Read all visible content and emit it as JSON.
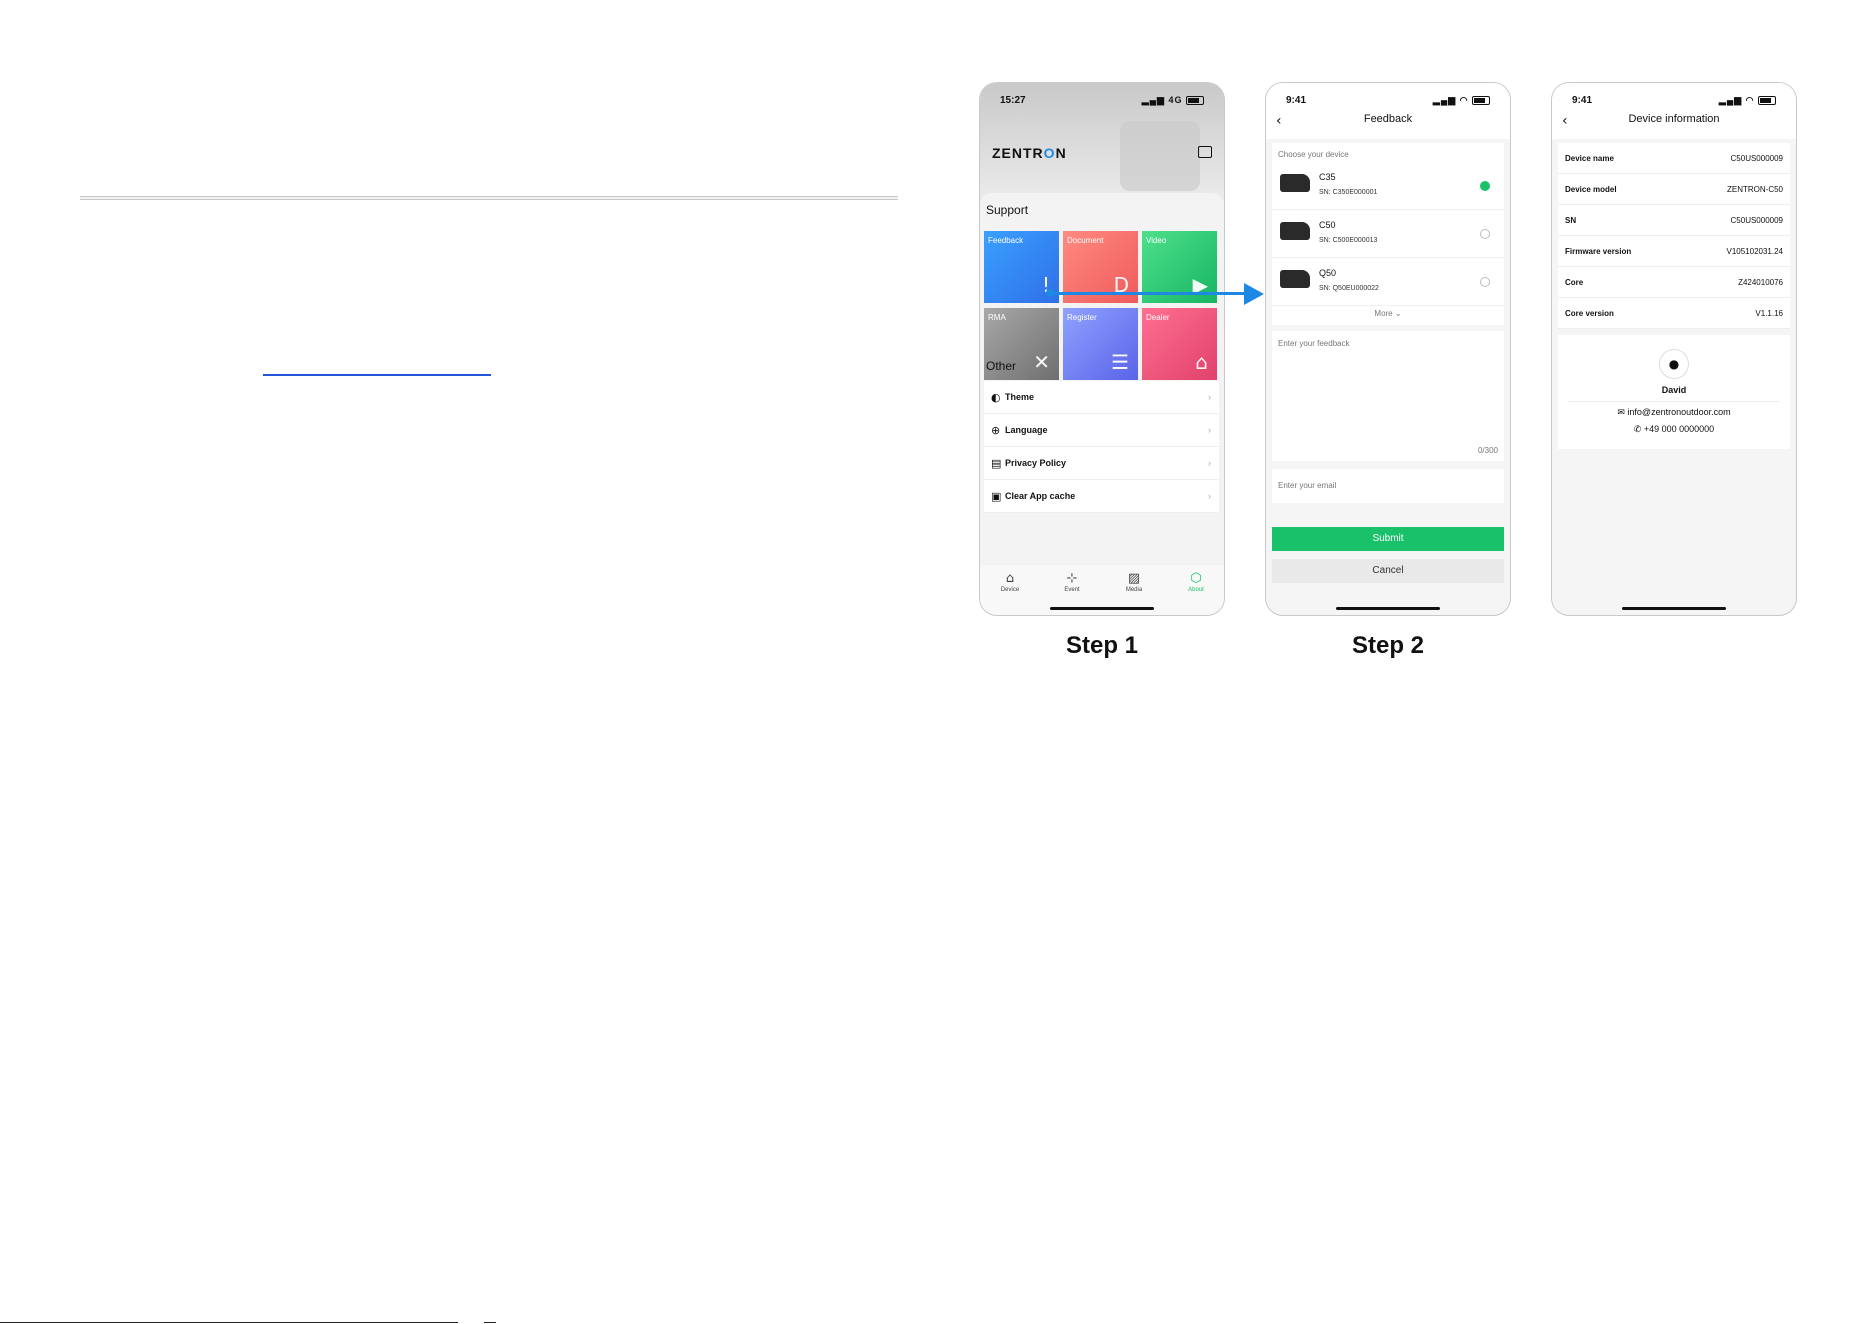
{
  "colors": {
    "accent_green": "#19c26a",
    "arrow_blue": "#1e88e5",
    "link_blue": "#2157d6"
  },
  "phone1": {
    "status_time": "15:27",
    "status_network": "4G",
    "logo_prefix": "ZENTR",
    "logo_o": "O",
    "logo_suffix": "N",
    "support_title": "Support",
    "tiles": [
      {
        "label": "Feedback",
        "icon": "feedback-icon",
        "glyph": "!"
      },
      {
        "label": "Document",
        "icon": "document-icon",
        "glyph": "D"
      },
      {
        "label": "Video",
        "icon": "video-icon",
        "glyph": "▶"
      },
      {
        "label": "RMA",
        "icon": "tools-icon",
        "glyph": "✕"
      },
      {
        "label": "Register",
        "icon": "list-icon",
        "glyph": "☰"
      },
      {
        "label": "Dealer",
        "icon": "store-icon",
        "glyph": "⌂"
      }
    ],
    "other_title": "Other",
    "other_items": [
      {
        "label": "Theme",
        "icon": "theme-icon",
        "glyph": "◐"
      },
      {
        "label": "Language",
        "icon": "globe-icon",
        "glyph": "⊕"
      },
      {
        "label": "Privacy Policy",
        "icon": "policy-icon",
        "glyph": "▤"
      },
      {
        "label": "Clear App cache",
        "icon": "trash-icon",
        "glyph": "▣"
      }
    ],
    "tabs": [
      {
        "label": "Device",
        "glyph": "⌂"
      },
      {
        "label": "Event",
        "glyph": "⊹"
      },
      {
        "label": "Media",
        "glyph": "▨"
      },
      {
        "label": "About",
        "glyph": "⬡"
      }
    ]
  },
  "phone2": {
    "status_time": "9:41",
    "title": "Feedback",
    "choose_label": "Choose your device",
    "devices": [
      {
        "name": "C35",
        "sn": "SN: C350E000001"
      },
      {
        "name": "C50",
        "sn": "SN: C500E000013"
      },
      {
        "name": "Q50",
        "sn": "SN: Q50EU000022"
      }
    ],
    "more": "More",
    "feedback_placeholder": "Enter your feedback",
    "counter": "0/300",
    "email_placeholder": "Enter your email",
    "submit": "Submit",
    "cancel": "Cancel"
  },
  "phone3": {
    "status_time": "9:41",
    "title": "Device information",
    "rows": [
      {
        "key": "Device name",
        "value": "C50US000009"
      },
      {
        "key": "Device model",
        "value": "ZENTRON-C50"
      },
      {
        "key": "SN",
        "value": "C50US000009"
      },
      {
        "key": "Firmware version",
        "value": "V105102031.24"
      },
      {
        "key": "Core",
        "value": "Z424010076"
      },
      {
        "key": "Core version",
        "value": "V1.1.16"
      }
    ],
    "contact_name": "David",
    "contact_email": "info@zentronoutdoor.com",
    "contact_phone": "+49 000 0000000"
  },
  "steps": {
    "step1": "Step 1",
    "step2": "Step 2"
  }
}
